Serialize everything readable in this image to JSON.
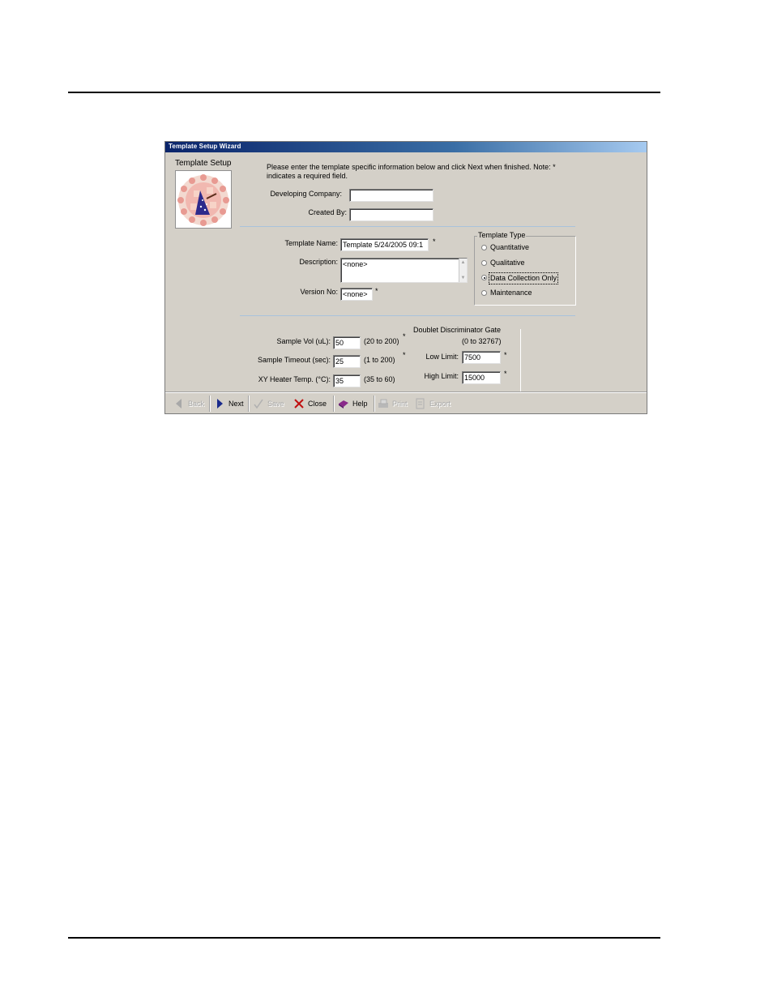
{
  "window": {
    "title": "Template Setup Wizard"
  },
  "sidebar": {
    "heading": "Template Setup"
  },
  "instructions": {
    "line1": "Please enter the template specific information below and click Next when finished.  Note: *",
    "line2": "indicates a required field."
  },
  "company": {
    "developing_company_label": "Developing Company:",
    "developing_company_value": "",
    "created_by_label": "Created By:",
    "created_by_value": ""
  },
  "template": {
    "name_label": "Template Name:",
    "name_value": "Template 5/24/2005 09:1",
    "description_label": "Description:",
    "description_value": "<none>",
    "version_label": "Version No:",
    "version_value": "<none>",
    "required_mark": "*"
  },
  "template_type": {
    "legend": "Template Type",
    "options": [
      "Quantitative",
      "Qualitative",
      "Data Collection Only",
      "Maintenance"
    ],
    "selected": "Data Collection Only"
  },
  "sample": {
    "vol_label": "Sample Vol (uL):",
    "vol_value": "50",
    "vol_range": "(20 to 200)",
    "timeout_label": "Sample Timeout (sec):",
    "timeout_value": "25",
    "timeout_range": "(1 to 200)",
    "heater_label": "XY Heater Temp. (°C):",
    "heater_value": "35",
    "heater_range": "(35 to 60)"
  },
  "doublet": {
    "title": "Doublet Discriminator Gate",
    "range": "(0 to 32767)",
    "low_label": "Low Limit:",
    "low_value": "7500",
    "high_label": "High Limit:",
    "high_value": "15000"
  },
  "toolbar": {
    "back": "Back",
    "next": "Next",
    "save": "Save",
    "close": "Close",
    "help": "Help",
    "print": "Print",
    "export": "Export"
  }
}
